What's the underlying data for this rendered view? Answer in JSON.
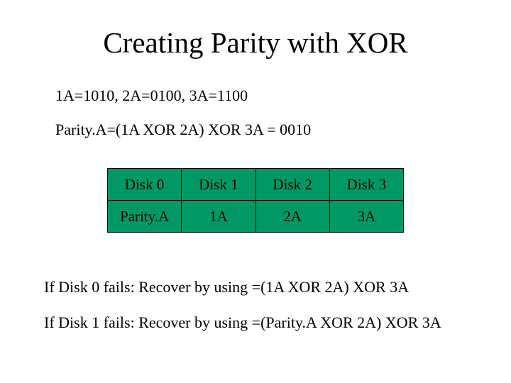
{
  "title": "Creating Parity with XOR",
  "line1": "1A=1010, 2A=0100, 3A=1100",
  "line2": "Parity.A=(1A XOR 2A) XOR 3A = 0010",
  "table": {
    "r0c0": "Disk 0",
    "r0c1": "Disk 1",
    "r0c2": "Disk 2",
    "r0c3": "Disk 3",
    "r1c0": "Parity.A",
    "r1c1": "1A",
    "r1c2": "2A",
    "r1c3": "3A"
  },
  "line3": "If Disk 0 fails: Recover by using =(1A XOR 2A) XOR 3A",
  "line4": "If Disk 1 fails: Recover by using =(Parity.A XOR 2A) XOR 3A"
}
